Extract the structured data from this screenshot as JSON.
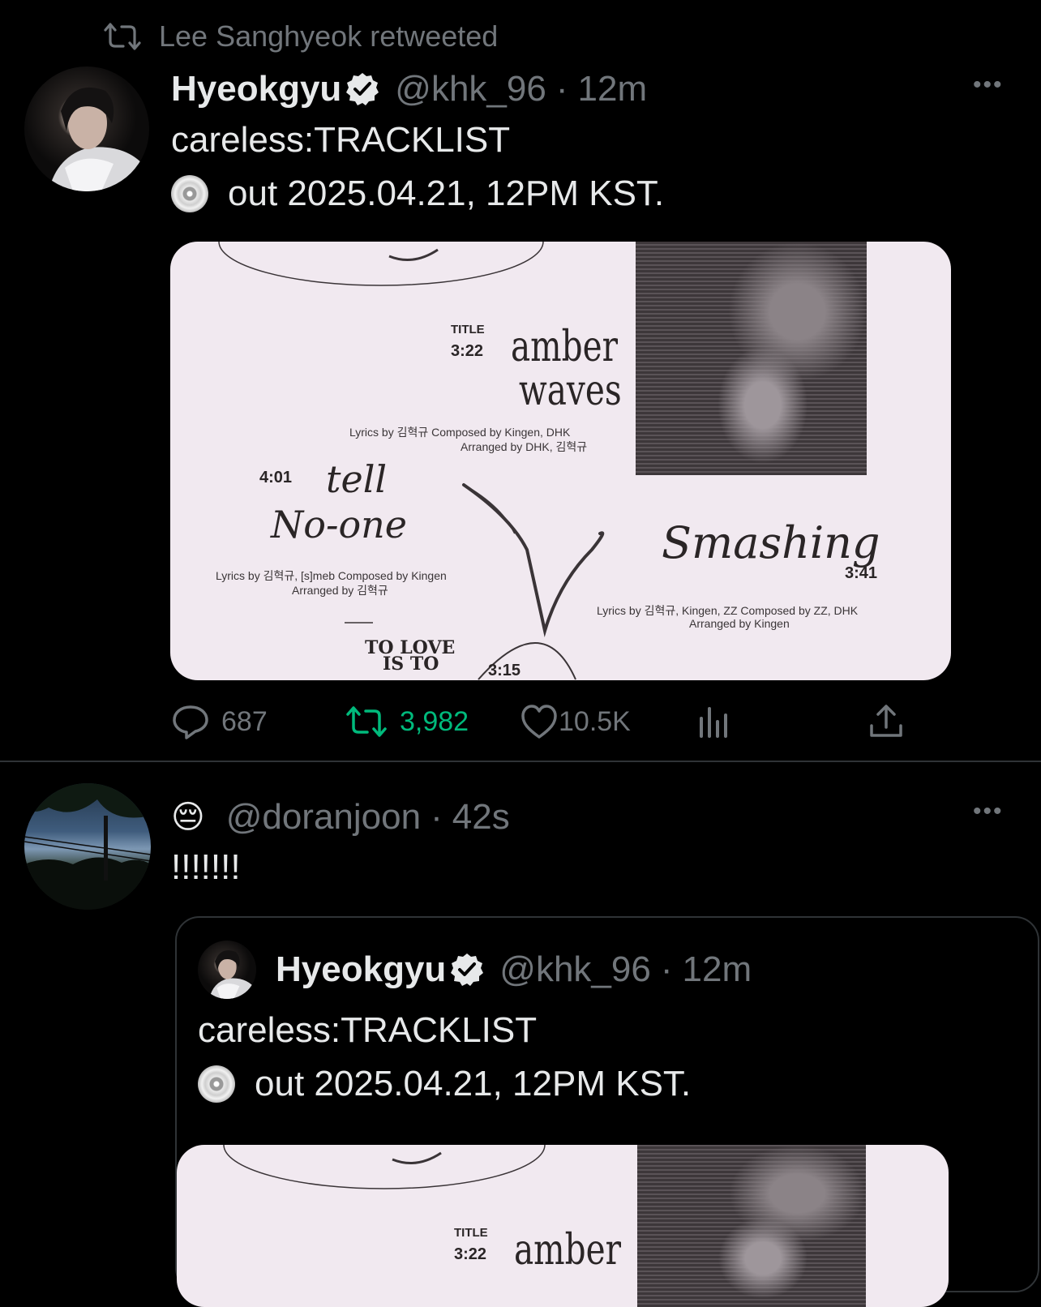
{
  "retweet_header": {
    "label": "Lee Sanghyeok retweeted"
  },
  "tweet": {
    "display_name": "Hyeokgyu",
    "handle": "@khk_96",
    "separator": "·",
    "time": "12m",
    "text_line1": "careless:TRACKLIST",
    "text_line2": "out 2025.04.21, 12PM KST.",
    "more": "•••",
    "media": {
      "title_tag": "TITLE",
      "t1_time": "3:22",
      "t1_title_a": "amber",
      "t1_title_b": "waves",
      "t1_credits_1": "Lyrics by 김혁규 Composed by Kingen, DHK",
      "t1_credits_2": "Arranged by DHK, 김혁규",
      "t2_time": "4:01",
      "t2_title_a": "tell",
      "t2_title_b": "No-one",
      "t2_credits_1": "Lyrics by 김혁규, [s]meb Composed by Kingen",
      "t2_credits_2": "Arranged by 김혁규",
      "t3_title": "Smashing",
      "t3_time": "3:41",
      "t3_credits_1": "Lyrics by 김혁규, Kingen, ZZ Composed by ZZ, DHK",
      "t3_credits_2": "Arranged by Kingen",
      "t4_title_a": "TO LOVE",
      "t4_title_b": "IS TO",
      "t4_time": "3:15"
    },
    "actions": {
      "replies": "687",
      "retweets": "3,982",
      "likes": "10.5K"
    },
    "colors": {
      "retweet_active": "#00ba7c",
      "muted": "#71767b"
    }
  },
  "reply_tweet": {
    "emoji": "😔",
    "handle": "@doranjoon",
    "separator": "·",
    "time": "42s",
    "text": "!!!!!!!",
    "more": "•••"
  },
  "quoted_tweet": {
    "display_name": "Hyeokgyu",
    "handle": "@khk_96",
    "separator": "·",
    "time": "12m",
    "text_line1": "careless:TRACKLIST",
    "text_line2": "out 2025.04.21, 12PM KST.",
    "media": {
      "title_tag": "TITLE",
      "t1_time": "3:22",
      "t1_title_a": "amber"
    }
  }
}
